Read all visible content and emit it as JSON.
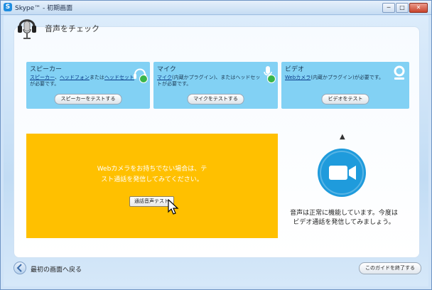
{
  "window": {
    "title": "Skype™ - 初期画面",
    "controls": {
      "minimize": "─",
      "maximize": "□",
      "close": "✕"
    }
  },
  "page": {
    "title": "音声をチェック"
  },
  "cards": {
    "speaker": {
      "title": "スピーカー",
      "desc_link1": "スピーカー",
      "desc_sep": "、",
      "desc_link2": "ヘッドフォン",
      "desc_mid": "または",
      "desc_link3": "ヘッドセット",
      "desc_end": "が必要です。",
      "button": "スピーカーをテストする"
    },
    "mic": {
      "title": "マイク",
      "desc_link1": "マイク",
      "desc_end": "(内蔵かプラグイン)、またはヘッドセットが必要です。",
      "button": "マイクをテストする"
    },
    "video": {
      "title": "ビデオ",
      "desc_link1": "Webカメラ",
      "desc_end": "(内蔵かプラグイン)が必要です。",
      "button": "ビデオをテスト"
    }
  },
  "test_panel": {
    "line1": "Webカメラをお持ちでない場合は、テ",
    "line2": "スト通話を発信してみてください。",
    "button": "通話音声テスト"
  },
  "result": {
    "line1": "音声は正常に機能しています。今度は",
    "line2": "ビデオ通話を発信してみましょう。"
  },
  "footer": {
    "back_label": "最初の画面へ戻る",
    "end_button": "このガイドを終了する"
  },
  "colors": {
    "card_bg": "#82d1f4",
    "test_panel_bg": "#ffc000",
    "video_icon": "#1f9bdc",
    "check": "#39b54a"
  },
  "icons": [
    "headset-icon",
    "headphones-icon",
    "microphone-icon",
    "webcam-icon",
    "check-icon",
    "video-camera-icon",
    "back-arrow-icon",
    "cursor-icon",
    "up-arrow-icon"
  ]
}
